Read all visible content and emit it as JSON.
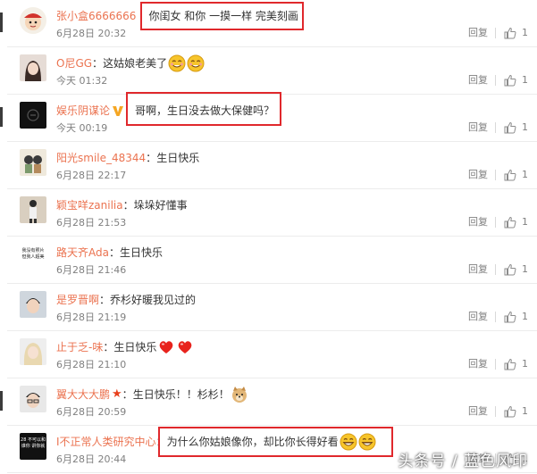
{
  "colors": {
    "username": "#eb7350",
    "highlight": "#e0282c",
    "muted": "#808080"
  },
  "actions": {
    "reply_label": "回复"
  },
  "comments": [
    {
      "user": "张小盒6666666",
      "sep": "",
      "text": "你闺女 和你 一摸一样 完美刻画",
      "time": "6月28日 20:32",
      "likes": "1",
      "emoji": [],
      "badge": "",
      "highlighted": true
    },
    {
      "user": "O尼GG",
      "sep": "：",
      "text": "这姑娘老美了",
      "time": "今天 01:32",
      "likes": "1",
      "emoji": [
        "smile-emoji",
        "smile-emoji"
      ],
      "badge": "",
      "highlighted": false
    },
    {
      "user": "娱乐阴谋论",
      "sep": "：",
      "text": "哥啊，生日没去做大保健吗？",
      "time": "今天 00:19",
      "likes": "1",
      "emoji": [],
      "badge": "verified-v-icon",
      "highlighted": true
    },
    {
      "user": "阳光smile_48344",
      "sep": "：",
      "text": "生日快乐",
      "time": "6月28日 22:17",
      "likes": "1",
      "emoji": [],
      "badge": "",
      "highlighted": false
    },
    {
      "user": "颖宝咩zanilia",
      "sep": "：",
      "text": "垛垛好懂事",
      "time": "6月28日 21:53",
      "likes": "1",
      "emoji": [],
      "badge": "",
      "highlighted": false
    },
    {
      "user": "路天齐Ada",
      "sep": "：",
      "text": "生日快乐",
      "time": "6月28日 21:46",
      "likes": "1",
      "emoji": [],
      "badge": "",
      "highlighted": false
    },
    {
      "user": "是罗晋啊",
      "sep": "：",
      "text": "乔杉好暖我见过的",
      "time": "6月28日 21:19",
      "likes": "1",
      "emoji": [],
      "badge": "",
      "highlighted": false
    },
    {
      "user": "止于乏-味",
      "sep": "：",
      "text": "生日快乐",
      "time": "6月28日 21:10",
      "likes": "1",
      "emoji": [
        "heart-emoji",
        "heart-emoji"
      ],
      "badge": "",
      "highlighted": false
    },
    {
      "user": "翼大大大鹏",
      "sep": "：",
      "text": "生日快乐！！杉杉！",
      "time": "6月28日 20:59",
      "likes": "1",
      "emoji": [
        "doge-emoji"
      ],
      "badge": "star-badge-icon",
      "highlighted": false
    },
    {
      "user": "I不正常人类研究中心",
      "sep": "：",
      "text": "为什么你姑娘像你，却比你长得好看",
      "time": "6月28日 20:44",
      "likes": "1",
      "emoji": [
        "grin-emoji",
        "grin-emoji"
      ],
      "badge": "",
      "highlighted": true
    }
  ],
  "avatars": [
    {
      "label": ""
    },
    {
      "label": ""
    },
    {
      "label": ""
    },
    {
      "label": ""
    },
    {
      "label": ""
    },
    {
      "label": "我没有照片 但我人超美"
    },
    {
      "label": ""
    },
    {
      "label": ""
    },
    {
      "label": ""
    },
    {
      "label": "28 不可以和谁你 讲你就"
    }
  ],
  "watermark": "头条号 / 蓝色风印"
}
